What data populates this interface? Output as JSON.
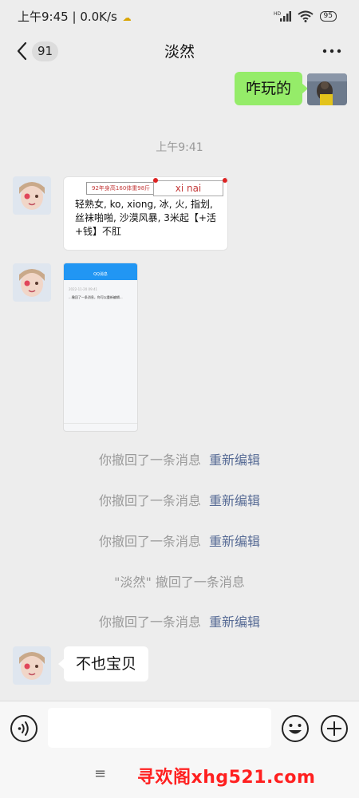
{
  "status_bar": {
    "time": "上午9:45",
    "separator": "|",
    "speed": "0.0K/s",
    "battery": "95"
  },
  "header": {
    "unread_badge": "91",
    "title": "淡然"
  },
  "messages": {
    "sent_text": "咋玩的",
    "timestamp": "上午9:41",
    "image_tag_small": "92年身高160体重98斤",
    "image_tag_name": "xi nai",
    "image_ad_text": "轻熟女, ko, xiong, 冰, 火, 指划, 丝袜啪啪, 沙漠风暴, 3米起【+活+钱】不肛",
    "screenshot_title": "QQ消息",
    "screenshot_line1": "2022-11-20 09:41",
    "screenshot_line2": "...撤回了一条消息，你可以重新编辑...",
    "recall_notice": "你撤回了一条消息",
    "reedit_link": "重新编辑",
    "other_recall_notice": "\"淡然\" 撤回了一条消息",
    "received_text": "不也宝贝"
  },
  "input": {
    "placeholder": ""
  },
  "bottom": {
    "menu_glyph": "≡",
    "watermark": "寻欢阁xhg521.com"
  }
}
